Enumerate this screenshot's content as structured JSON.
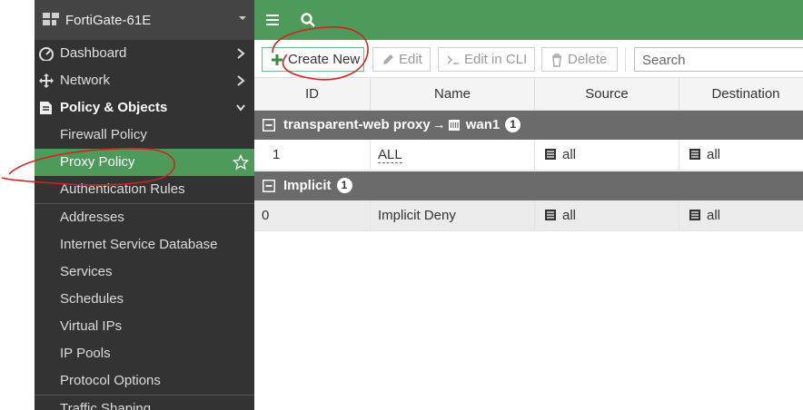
{
  "sidebar": {
    "device_name": "FortiGate-61E",
    "nav": [
      {
        "label": "Dashboard",
        "icon": "dashboard-icon"
      },
      {
        "label": "Network",
        "icon": "network-icon"
      },
      {
        "label": "Policy & Objects",
        "icon": "policy-icon"
      }
    ],
    "policy_items": [
      "Firewall Policy",
      "Proxy Policy",
      "Authentication Rules",
      "Addresses",
      "Internet Service Database",
      "Services",
      "Schedules",
      "Virtual IPs",
      "IP Pools",
      "Protocol Options",
      "Traffic Shaping"
    ],
    "active_item": "Proxy Policy"
  },
  "toolbar": {
    "create_new": "Create New",
    "edit": "Edit",
    "edit_in_cli": "Edit in CLI",
    "delete": "Delete",
    "search_placeholder": "Search"
  },
  "table": {
    "columns": [
      "ID",
      "Name",
      "Source",
      "Destination"
    ],
    "groups": [
      {
        "label_from": "transparent-web proxy",
        "arrow": "→",
        "label_to": "wan1",
        "count": "1",
        "rows": [
          {
            "id": "1",
            "name": "ALL",
            "source": "all",
            "destination": "all"
          }
        ]
      },
      {
        "label_from": "Implicit",
        "count": "1",
        "rows": [
          {
            "id": "0",
            "name": "Implicit Deny",
            "source": "all",
            "destination": "all"
          }
        ]
      }
    ]
  },
  "colors": {
    "accent_green": "#4e9a5a",
    "sidebar_bg": "#333333",
    "annotation_red": "#d42020"
  }
}
